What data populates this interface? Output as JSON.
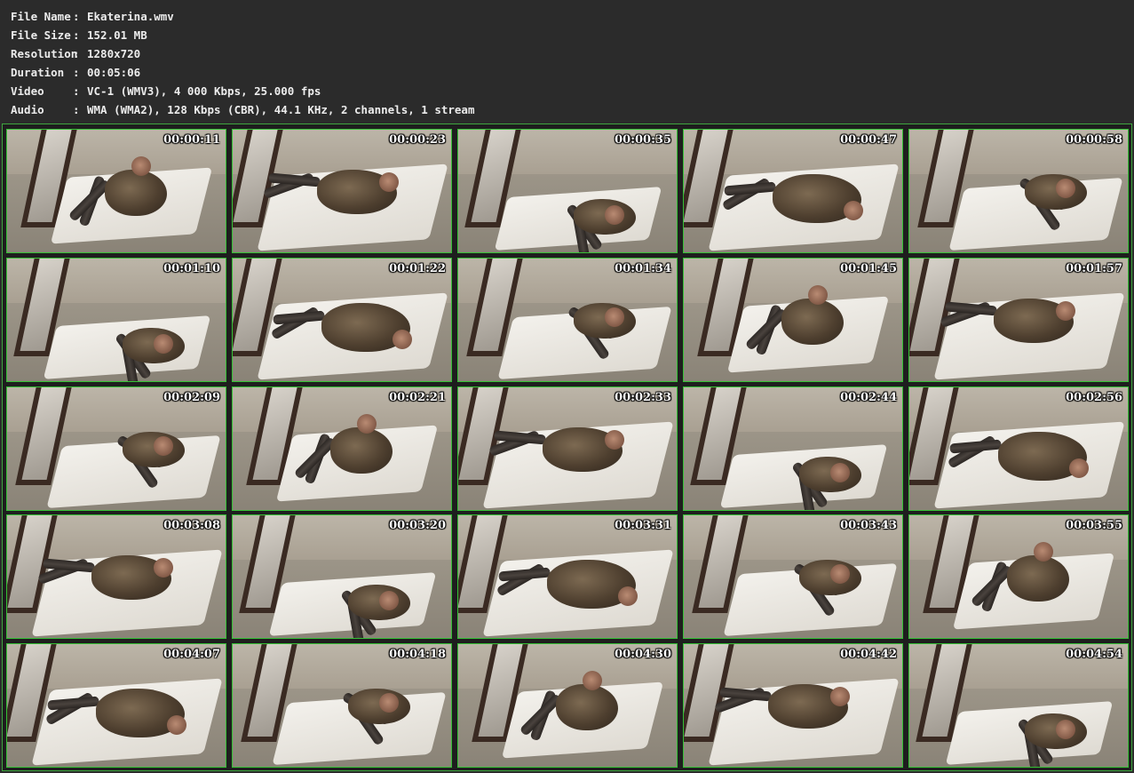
{
  "file_info": [
    {
      "label": "File Name",
      "sep": ":",
      "value": "Ekaterina.wmv"
    },
    {
      "label": "File Size",
      "sep": ":",
      "value": "152.01 MB"
    },
    {
      "label": "Resolution",
      "sep": ":",
      "value": "1280x720"
    },
    {
      "label": "Duration",
      "sep": ":",
      "value": "00:05:06"
    },
    {
      "label": "Video",
      "sep": ":",
      "value": "VC-1 (WMV3), 4 000 Kbps, 25.000 fps"
    },
    {
      "label": "Audio",
      "sep": ":",
      "value": "WMA (WMA2), 128 Kbps (CBR), 44.1 KHz, 2 channels, 1 stream"
    }
  ],
  "thumbnails": [
    {
      "time": "00:00:11"
    },
    {
      "time": "00:00:23"
    },
    {
      "time": "00:00:35"
    },
    {
      "time": "00:00:47"
    },
    {
      "time": "00:00:58"
    },
    {
      "time": "00:01:10"
    },
    {
      "time": "00:01:22"
    },
    {
      "time": "00:01:34"
    },
    {
      "time": "00:01:45"
    },
    {
      "time": "00:01:57"
    },
    {
      "time": "00:02:09"
    },
    {
      "time": "00:02:21"
    },
    {
      "time": "00:02:33"
    },
    {
      "time": "00:02:44"
    },
    {
      "time": "00:02:56"
    },
    {
      "time": "00:03:08"
    },
    {
      "time": "00:03:20"
    },
    {
      "time": "00:03:31"
    },
    {
      "time": "00:03:43"
    },
    {
      "time": "00:03:55"
    },
    {
      "time": "00:04:07"
    },
    {
      "time": "00:04:18"
    },
    {
      "time": "00:04:30"
    },
    {
      "time": "00:04:42"
    },
    {
      "time": "00:04:54"
    }
  ],
  "colors": {
    "background": "#2b2b2b",
    "frame_border": "#35c035",
    "text": "#ececec"
  }
}
